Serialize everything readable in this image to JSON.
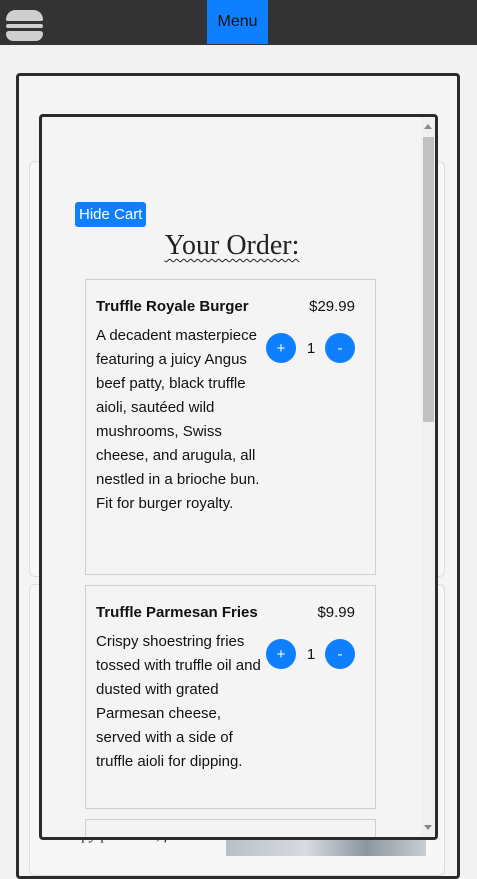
{
  "header": {
    "menu_label": "Menu",
    "logo_icon": "burger-icon"
  },
  "background": {
    "partial_text": "crispy pancetta, fresh"
  },
  "cart": {
    "hide_label": "Hide Cart",
    "title": "Your Order:",
    "items": [
      {
        "name": "Truffle Royale Burger",
        "price": "$29.99",
        "description": "A decadent masterpiece featuring a juicy Angus beef patty, black truffle aioli, sautéed wild mushrooms, Swiss cheese, and arugula, all nestled in a brioche bun. Fit for burger royalty.",
        "quantity": "1",
        "plus_label": "+",
        "minus_label": "-"
      },
      {
        "name": "Truffle Parmesan Fries",
        "price": "$9.99",
        "description": "Crispy shoestring fries tossed with truffle oil and dusted with grated Parmesan cheese, served with a side of truffle aioli for dipping.",
        "quantity": "1",
        "plus_label": "+",
        "minus_label": "-"
      }
    ]
  },
  "colors": {
    "accent": "#0d7fff",
    "topbar": "#333333"
  }
}
